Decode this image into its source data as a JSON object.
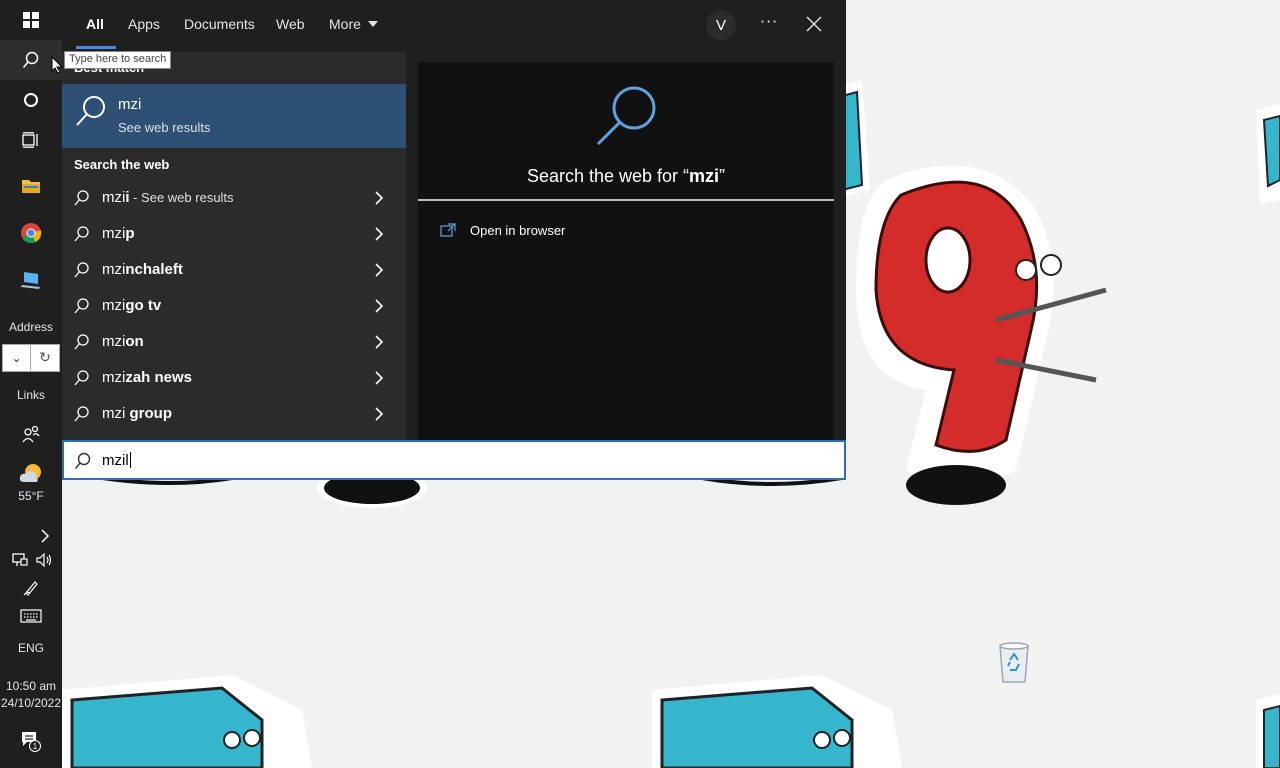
{
  "taskbar": {
    "address_label": "Address",
    "links_label": "Links",
    "weather_temp": "55°F",
    "language": "ENG",
    "time": "10:50 am",
    "date": "24/10/2022",
    "notification_count": "1",
    "icons": [
      "windows-start-icon",
      "search-icon",
      "cortana-icon",
      "task-view-icon",
      "file-explorer-icon",
      "chrome-icon",
      "this-pc-icon",
      "people-icon",
      "weather-icon",
      "show-hidden-icon",
      "network-icon",
      "volume-icon",
      "pen-icon",
      "keyboard-icon",
      "notification-icon"
    ]
  },
  "tooltip": "Type here to search",
  "search": {
    "tabs": [
      "All",
      "Apps",
      "Documents",
      "Web",
      "More"
    ],
    "active_tab": "All",
    "avatar_letter": "V",
    "best_match_label": "Best match",
    "best_match": {
      "title": "mzi",
      "subtitle": "See web results"
    },
    "search_web_label": "Search the web",
    "suggestions": [
      {
        "prefix": "mzi",
        "rest": "i",
        "sub": " - See web results"
      },
      {
        "prefix": "mzi",
        "rest": "p",
        "sub": ""
      },
      {
        "prefix": "mzi",
        "rest": "nchaleft",
        "sub": ""
      },
      {
        "prefix": "mzi",
        "rest": "go tv",
        "sub": ""
      },
      {
        "prefix": "mzi",
        "rest": "on",
        "sub": ""
      },
      {
        "prefix": "mzi",
        "rest": "zah news",
        "sub": ""
      },
      {
        "prefix": "mzi",
        "rest": " group",
        "sub": ""
      }
    ],
    "preview_title_prefix": "Search the web for “",
    "preview_query": "mzi",
    "preview_title_suffix": "”",
    "open_in_browser": "Open in browser",
    "input_value": "mzil"
  },
  "colors": {
    "accent": "#2c6db5",
    "selected": "#2d5074",
    "taskbar": "#1f1f1f",
    "panel": "#2b2b2b"
  }
}
